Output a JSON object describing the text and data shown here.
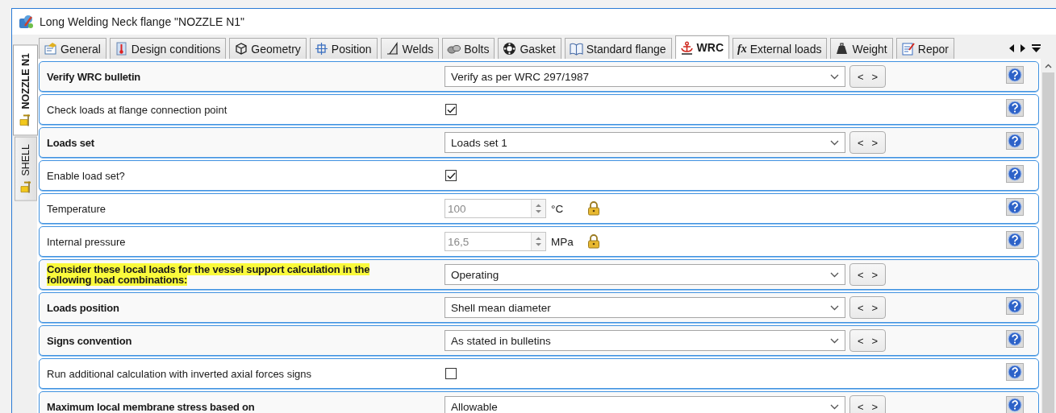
{
  "window": {
    "title": "Long Welding Neck flange \"NOZZLE N1\""
  },
  "side_tabs": [
    {
      "label": "NOZZLE N1",
      "selected": true
    },
    {
      "label": "SHELL",
      "selected": false
    }
  ],
  "tabs": [
    {
      "label": "General",
      "selected": false
    },
    {
      "label": "Design conditions",
      "selected": false
    },
    {
      "label": "Geometry",
      "selected": false
    },
    {
      "label": "Position",
      "selected": false
    },
    {
      "label": "Welds",
      "selected": false
    },
    {
      "label": "Bolts",
      "selected": false
    },
    {
      "label": "Gasket",
      "selected": false
    },
    {
      "label": "Standard flange",
      "selected": false
    },
    {
      "label": "WRC",
      "selected": true
    },
    {
      "label": "External loads",
      "selected": false,
      "icon_text": "fx"
    },
    {
      "label": "Weight",
      "selected": false
    },
    {
      "label": "Repor",
      "selected": false
    }
  ],
  "rows": [
    {
      "kind": "dropdown",
      "label": "Verify WRC bulletin",
      "bold": true,
      "highlighted": false,
      "value": "Verify as per WRC 297/1987",
      "stepper": [
        "<",
        ">"
      ],
      "help": true
    },
    {
      "kind": "checkbox",
      "label": "Check loads at flange connection point",
      "bold": false,
      "highlighted": false,
      "checked": true,
      "help": true
    },
    {
      "kind": "dropdown",
      "label": "Loads set",
      "bold": true,
      "highlighted": false,
      "value": "Loads set 1",
      "stepper": [
        "<",
        ">"
      ],
      "help": true
    },
    {
      "kind": "checkbox",
      "label": "Enable load set?",
      "bold": false,
      "highlighted": false,
      "checked": true,
      "help": true
    },
    {
      "kind": "spin",
      "label": "Temperature",
      "bold": false,
      "highlighted": false,
      "value": "100",
      "unit": "°C",
      "disabled": true,
      "locked": true,
      "help": true
    },
    {
      "kind": "spin",
      "label": "Internal pressure",
      "bold": false,
      "highlighted": false,
      "value": "16,5",
      "unit": "MPa",
      "disabled": true,
      "locked": true,
      "help": true
    },
    {
      "kind": "dropdown",
      "label": "Consider these local loads for the vessel support calculation in the following load combinations:",
      "bold": true,
      "highlighted": true,
      "value": "Operating",
      "stepper": [
        "<",
        ">"
      ],
      "help": false
    },
    {
      "kind": "dropdown",
      "label": "Loads position",
      "bold": true,
      "highlighted": false,
      "value": "Shell mean diameter",
      "stepper": [
        "<",
        ">"
      ],
      "help": true
    },
    {
      "kind": "dropdown",
      "label": "Signs convention",
      "bold": true,
      "highlighted": false,
      "value": "As stated in bulletins",
      "stepper": [
        "<",
        ">"
      ],
      "help": true
    },
    {
      "kind": "checkbox",
      "label": "Run additional calculation with inverted axial forces signs",
      "bold": false,
      "highlighted": false,
      "checked": false,
      "help": true
    },
    {
      "kind": "dropdown",
      "label": "Maximum local membrane stress based on",
      "bold": true,
      "highlighted": false,
      "value": "Allowable",
      "stepper": [
        "<",
        ">"
      ],
      "help": true
    }
  ]
}
